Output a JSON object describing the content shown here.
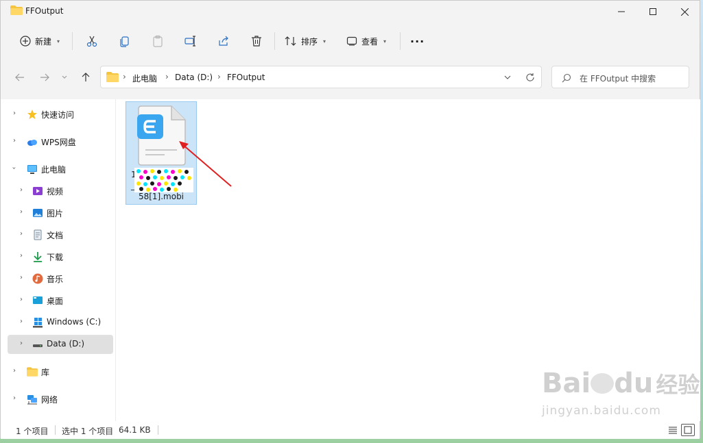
{
  "window": {
    "title": "FFOutput"
  },
  "toolbar": {
    "new_label": "新建",
    "sort_label": "排序",
    "view_label": "查看",
    "more_label": "···"
  },
  "address": {
    "crumbs": [
      "此电脑",
      "Data (D:)",
      "FFOutput"
    ]
  },
  "search": {
    "placeholder": "在 FFOutput 中搜索"
  },
  "sidebar": {
    "items": [
      {
        "label": "快速访问",
        "icon": "star-icon"
      },
      {
        "label": "WPS网盘",
        "icon": "cloud-icon"
      },
      {
        "label": "此电脑",
        "icon": "computer-icon"
      },
      {
        "label": "视频",
        "icon": "video-icon"
      },
      {
        "label": "图片",
        "icon": "pictures-icon"
      },
      {
        "label": "文档",
        "icon": "document-icon"
      },
      {
        "label": "下载",
        "icon": "download-icon"
      },
      {
        "label": "音乐",
        "icon": "music-icon"
      },
      {
        "label": "桌面",
        "icon": "desktop-icon"
      },
      {
        "label": "Windows (C:)",
        "icon": "drive-icon"
      },
      {
        "label": "Data (D:)",
        "icon": "drive-icon",
        "selected": true
      },
      {
        "label": "库",
        "icon": "library-icon"
      },
      {
        "label": "网络",
        "icon": "network-icon"
      }
    ]
  },
  "file": {
    "line1": "1574",
    "line2": "_2",
    "line3_tail": "102",
    "line4": "58[1].mobi",
    "icon": "mobi-file-icon"
  },
  "status": {
    "item_count": "1 个项目",
    "selected": "选中 1 个项目",
    "size": "64.1 KB"
  },
  "colors": {
    "accent": "#0067c0",
    "selection": "#cce4f7",
    "arrow": "#e02020"
  },
  "watermark": {
    "brand": "Bai",
    "brand2": "du",
    "cn": "经验",
    "url": "jingyan.baidu.com"
  }
}
